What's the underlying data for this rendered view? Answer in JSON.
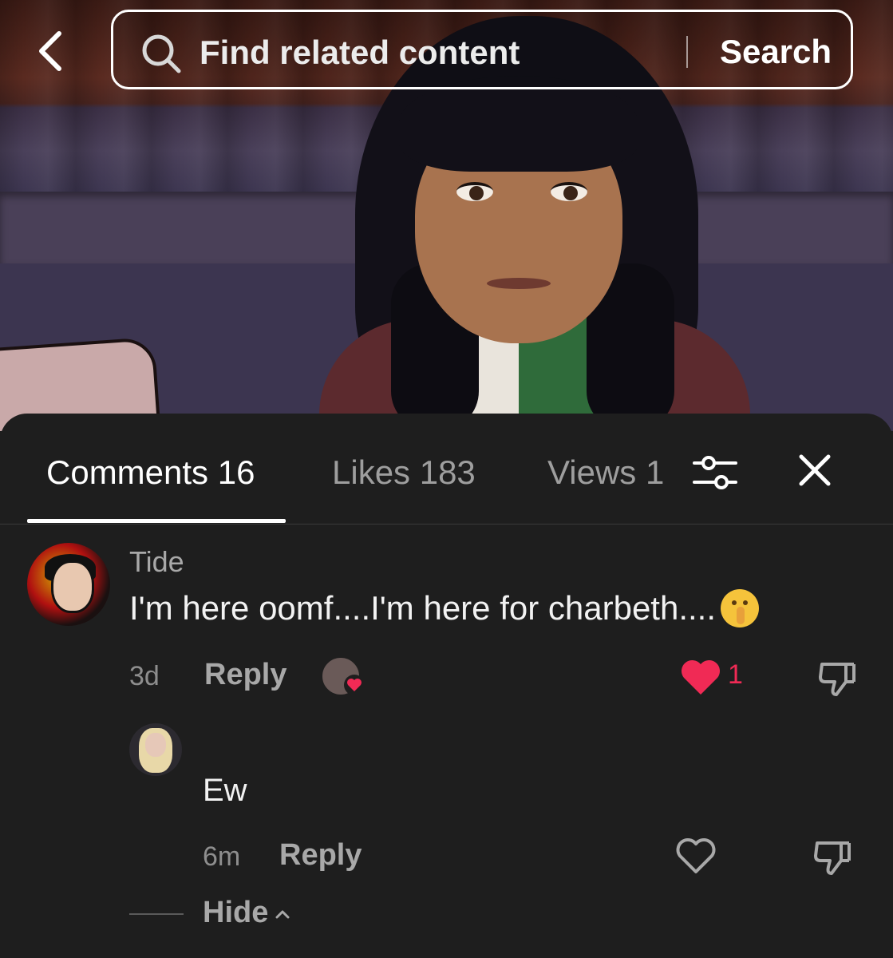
{
  "search": {
    "placeholder": "Find related content",
    "button_label": "Search"
  },
  "tabs": [
    {
      "label": "Comments 16",
      "active": true
    },
    {
      "label": "Likes 183",
      "active": false
    },
    {
      "label": "Views 1",
      "active": false
    }
  ],
  "comments": [
    {
      "username": "Tide",
      "text": "I'm here oomf....I'm here for charbeth....",
      "emoji": "shushing-face",
      "time": "3d",
      "reply_label": "Reply",
      "liked_by_creator": true,
      "like_count": "1",
      "liked": true
    }
  ],
  "replies": [
    {
      "username": "",
      "text": "Ew",
      "time": "6m",
      "reply_label": "Reply",
      "liked": false
    }
  ],
  "hide_label": "Hide",
  "colors": {
    "panel_bg": "#1e1e1e",
    "like_red": "#f02a55",
    "muted_text": "#a8a8a8"
  }
}
